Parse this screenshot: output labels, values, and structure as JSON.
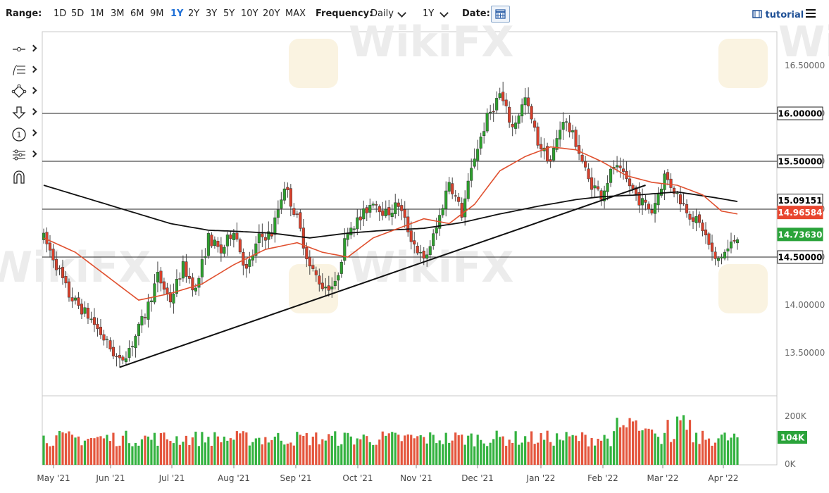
{
  "toolbar": {
    "range_label": "Range:",
    "ranges": [
      "1D",
      "5D",
      "1M",
      "3M",
      "6M",
      "9M",
      "1Y",
      "2Y",
      "3Y",
      "5Y",
      "10Y",
      "20Y",
      "MAX"
    ],
    "active_range": "1Y",
    "frequency_label": "Frequency:",
    "frequency_value": "Daily",
    "period_value": "1Y",
    "date_label": "Date:",
    "tutorial_label": "tutorial"
  },
  "drawing_tools": [
    "line-tool-icon",
    "fib-tool-icon",
    "shape-tool-icon",
    "arrow-tool-icon",
    "label-tool-icon",
    "measure-tool-icon",
    "magnet-icon"
  ],
  "watermark": "WikiFX",
  "colors": {
    "up": "#2ca02c",
    "down": "#d9402b",
    "ma50": "#e0502f",
    "ma200": "#111111",
    "trend": "#111111",
    "volume_up": "#33b23f",
    "volume_down": "#e4553c"
  },
  "chart_data": {
    "type": "candlestick",
    "price_axis": {
      "ticks": [
        16.5,
        16.0,
        15.5,
        15.0,
        14.5,
        14.0,
        13.5
      ],
      "tick_labels": [
        "16.50000",
        "16.00000",
        "15.50000",
        "15.00000",
        "14.50000",
        "14.00000",
        "13.50000"
      ],
      "ylim": [
        13.2,
        16.75
      ]
    },
    "horizontal_lines": [
      16.0,
      15.5,
      15.0,
      14.5
    ],
    "price_tags": [
      {
        "value": "16.00000",
        "level": 16.0,
        "style": "dark"
      },
      {
        "value": "15.50000",
        "level": 15.5,
        "style": "dark"
      },
      {
        "value": "15.09151",
        "level": 15.09151,
        "style": "dark"
      },
      {
        "value": "14.96584",
        "level": 14.96584,
        "style": "red"
      },
      {
        "value": "14.73630",
        "level": 14.7363,
        "style": "green"
      },
      {
        "value": "14.50000",
        "level": 14.5,
        "style": "dark"
      }
    ],
    "x_labels": [
      "May '21",
      "Jun '21",
      "Jul '21",
      "Aug '21",
      "Sep '21",
      "Oct '21",
      "Nov '21",
      "Dec '21",
      "Jan '22",
      "Feb '22",
      "Mar '22",
      "Apr '22"
    ],
    "price_path_anchors": [
      [
        0,
        14.7
      ],
      [
        3,
        14.5
      ],
      [
        8,
        14.1
      ],
      [
        15,
        13.85
      ],
      [
        20,
        13.6
      ],
      [
        24,
        13.4
      ],
      [
        28,
        13.6
      ],
      [
        32,
        13.9
      ],
      [
        36,
        14.3
      ],
      [
        40,
        14.05
      ],
      [
        44,
        14.4
      ],
      [
        48,
        14.15
      ],
      [
        52,
        14.7
      ],
      [
        56,
        14.55
      ],
      [
        60,
        14.8
      ],
      [
        64,
        14.35
      ],
      [
        68,
        14.7
      ],
      [
        72,
        14.75
      ],
      [
        76,
        15.25
      ],
      [
        80,
        14.9
      ],
      [
        84,
        14.4
      ],
      [
        88,
        14.2
      ],
      [
        92,
        14.2
      ],
      [
        96,
        14.8
      ],
      [
        100,
        14.9
      ],
      [
        104,
        15.1
      ],
      [
        108,
        14.95
      ],
      [
        112,
        15.05
      ],
      [
        116,
        14.7
      ],
      [
        120,
        14.45
      ],
      [
        124,
        14.8
      ],
      [
        128,
        15.3
      ],
      [
        132,
        14.95
      ],
      [
        136,
        15.55
      ],
      [
        140,
        15.95
      ],
      [
        144,
        16.2
      ],
      [
        148,
        15.85
      ],
      [
        152,
        16.15
      ],
      [
        156,
        15.7
      ],
      [
        160,
        15.5
      ],
      [
        164,
        15.95
      ],
      [
        168,
        15.7
      ],
      [
        172,
        15.3
      ],
      [
        176,
        15.15
      ],
      [
        180,
        15.45
      ],
      [
        184,
        15.3
      ],
      [
        188,
        15.1
      ],
      [
        192,
        14.98
      ],
      [
        196,
        15.35
      ],
      [
        200,
        15.15
      ],
      [
        204,
        14.95
      ],
      [
        208,
        14.8
      ],
      [
        212,
        14.45
      ],
      [
        216,
        14.58
      ],
      [
        219,
        14.73
      ]
    ],
    "ma50_anchors": [
      [
        0,
        14.7
      ],
      [
        10,
        14.55
      ],
      [
        20,
        14.3
      ],
      [
        30,
        14.05
      ],
      [
        40,
        14.12
      ],
      [
        50,
        14.22
      ],
      [
        60,
        14.42
      ],
      [
        70,
        14.58
      ],
      [
        80,
        14.65
      ],
      [
        88,
        14.55
      ],
      [
        96,
        14.5
      ],
      [
        104,
        14.7
      ],
      [
        112,
        14.8
      ],
      [
        120,
        14.9
      ],
      [
        128,
        14.85
      ],
      [
        136,
        15.05
      ],
      [
        144,
        15.4
      ],
      [
        152,
        15.55
      ],
      [
        160,
        15.65
      ],
      [
        168,
        15.62
      ],
      [
        176,
        15.5
      ],
      [
        184,
        15.35
      ],
      [
        192,
        15.28
      ],
      [
        200,
        15.25
      ],
      [
        208,
        15.15
      ],
      [
        214,
        14.98
      ],
      [
        219,
        14.95
      ]
    ],
    "ma200_anchors": [
      [
        0,
        15.25
      ],
      [
        20,
        15.05
      ],
      [
        40,
        14.85
      ],
      [
        52,
        14.78
      ],
      [
        60,
        14.77
      ],
      [
        72,
        14.75
      ],
      [
        84,
        14.7
      ],
      [
        96,
        14.75
      ],
      [
        108,
        14.78
      ],
      [
        120,
        14.8
      ],
      [
        132,
        14.86
      ],
      [
        144,
        14.95
      ],
      [
        156,
        15.03
      ],
      [
        168,
        15.1
      ],
      [
        176,
        15.13
      ],
      [
        188,
        15.15
      ],
      [
        200,
        15.18
      ],
      [
        212,
        15.12
      ],
      [
        219,
        15.08
      ]
    ],
    "trendline": {
      "from": [
        24,
        13.35
      ],
      "to": [
        190,
        15.25
      ]
    },
    "volume_axis": {
      "tick_labels": [
        "200K",
        "0K"
      ],
      "ymax": 240000
    },
    "volume_tag": "104K",
    "volume_last": 104000,
    "bars": 220
  }
}
